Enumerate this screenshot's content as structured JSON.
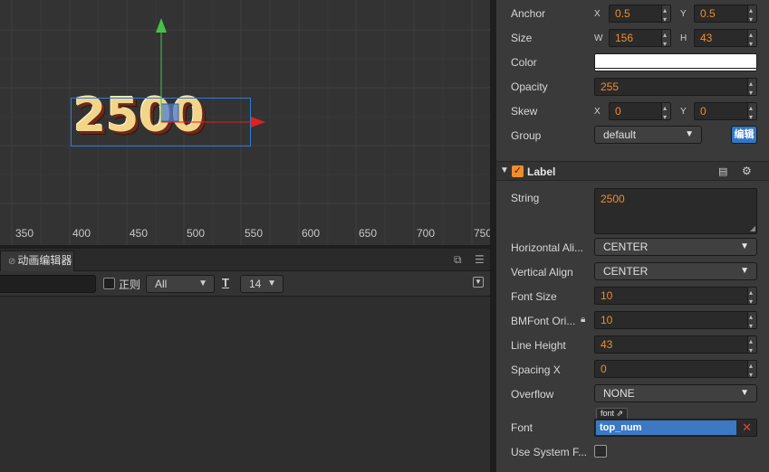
{
  "scene": {
    "ruler_labels": [
      "350",
      "400",
      "450",
      "500",
      "550",
      "600",
      "650",
      "700",
      "750"
    ],
    "label_preview_text": "2500"
  },
  "animation_editor": {
    "tab_title": "动画编辑器",
    "regex_label": "正则",
    "filter_value": "All",
    "font_size_value": "14",
    "font_size_icon": "T"
  },
  "inspector": {
    "anchor": {
      "label": "Anchor",
      "x_axis": "X",
      "x": "0.5",
      "y_axis": "Y",
      "y": "0.5"
    },
    "size": {
      "label": "Size",
      "w_axis": "W",
      "w": "156",
      "h_axis": "H",
      "h": "43"
    },
    "color": {
      "label": "Color",
      "value_hex": "#ffffff"
    },
    "opacity": {
      "label": "Opacity",
      "value": "255"
    },
    "skew": {
      "label": "Skew",
      "x_axis": "X",
      "x": "0",
      "y_axis": "Y",
      "y": "0"
    },
    "group": {
      "label": "Group",
      "value": "default",
      "edit_label": "编辑"
    },
    "label_component": {
      "title": "Label",
      "enabled": true,
      "string": {
        "label": "String",
        "value": "2500"
      },
      "horizontal_align": {
        "label": "Horizontal Ali...",
        "value": "CENTER"
      },
      "vertical_align": {
        "label": "Vertical Align",
        "value": "CENTER"
      },
      "font_size": {
        "label": "Font Size",
        "value": "10"
      },
      "bmfont_original_size": {
        "label": "BMFont Ori...",
        "value": "10"
      },
      "line_height": {
        "label": "Line Height",
        "value": "43"
      },
      "spacing_x": {
        "label": "Spacing X",
        "value": "0"
      },
      "overflow": {
        "label": "Overflow",
        "value": "NONE"
      },
      "font": {
        "label": "Font",
        "type_tag": "font",
        "asset": "top_num"
      },
      "use_system_font": {
        "label": "Use System F...",
        "checked": false
      }
    }
  },
  "colors": {
    "accent_orange": "#f08c2c",
    "accent_blue": "#3178c6",
    "panel_bg": "#3a3a3a"
  }
}
